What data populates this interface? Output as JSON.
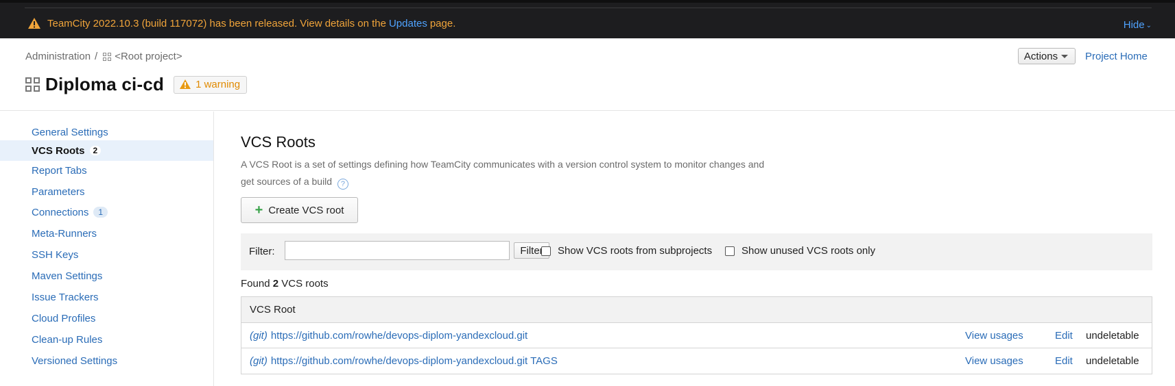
{
  "banner": {
    "text_before": "TeamCity 2022.10.3 (build 117072) has been released. View details on the",
    "link": "Updates",
    "text_after": "page.",
    "hide_label": "Hide"
  },
  "breadcrumb": {
    "items": [
      "Administration",
      "<Root project>"
    ],
    "separator": "/"
  },
  "header": {
    "title": "Diploma ci-cd",
    "warning_badge": "1 warning",
    "actions_label": "Actions",
    "project_home_label": "Project Home"
  },
  "sidebar": {
    "items": [
      {
        "label": "General Settings"
      },
      {
        "label": "VCS Roots",
        "count": "2",
        "active": true
      },
      {
        "label": "Report Tabs"
      },
      {
        "label": "Parameters"
      },
      {
        "label": "Connections",
        "count": "1"
      },
      {
        "label": "Meta-Runners"
      },
      {
        "label": "SSH Keys"
      },
      {
        "label": "Maven Settings"
      },
      {
        "label": "Issue Trackers"
      },
      {
        "label": "Cloud Profiles"
      },
      {
        "label": "Clean-up Rules"
      },
      {
        "label": "Versioned Settings"
      }
    ]
  },
  "main": {
    "title": "VCS Roots",
    "description_line1": "A VCS Root is a set of settings defining how TeamCity communicates with a version control system to monitor changes and",
    "description_line2": "get sources of a build",
    "help_icon": "?",
    "create_button": "Create VCS root",
    "filter": {
      "label": "Filter:",
      "value": "",
      "button": "Filter",
      "checkbox_subprojects": "Show VCS roots from subprojects",
      "checkbox_unused": "Show unused VCS roots only"
    },
    "found_prefix": "Found",
    "found_count": "2",
    "found_suffix": "VCS roots",
    "table": {
      "header": "VCS Root",
      "rows": [
        {
          "type": "(git)",
          "url": "https://github.com/rowhe/devops-diplom-yandexcloud.git",
          "usages": "View usages",
          "edit": "Edit",
          "status": "undeletable"
        },
        {
          "type": "(git)",
          "url": "https://github.com/rowhe/devops-diplom-yandexcloud.git TAGS",
          "usages": "View usages",
          "edit": "Edit",
          "status": "undeletable"
        }
      ]
    }
  },
  "colors": {
    "banner_bg": "#1d1d1f",
    "banner_text": "#f0a43a",
    "link": "#2a6cb7",
    "active_bg": "#e8f1fb",
    "warning": "#e08a00"
  }
}
